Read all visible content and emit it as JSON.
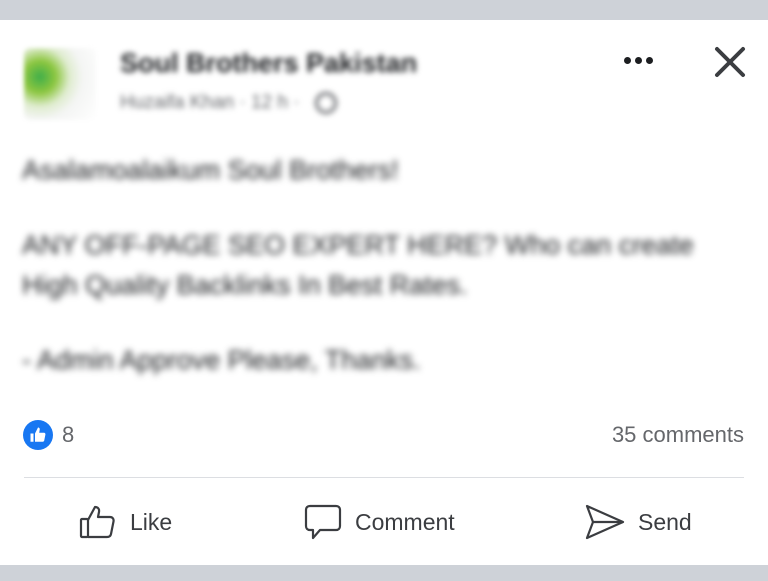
{
  "header": {
    "group_name": "Soul Brothers Pakistan",
    "author": "Huzaifa Khan",
    "time": "· 12 h ·"
  },
  "post": {
    "paragraphs": [
      "Asalamoalaikum Soul Brothers!",
      "ANY OFF-PAGE SEO EXPERT HERE? Who can create High Quality Backlinks In Best Rates.",
      "- Admin Approve Please, Thanks."
    ]
  },
  "stats": {
    "reaction_count": "8",
    "comments": "35 comments"
  },
  "actions": {
    "like": "Like",
    "comment": "Comment",
    "send": "Send"
  },
  "icons": {
    "reaction": "thumbs-up-icon",
    "more": "more-dots-icon",
    "close": "close-icon",
    "privacy": "globe-icon",
    "comment": "comment-bubble-icon",
    "send": "send-icon"
  },
  "colors": {
    "brand_blue": "#1877f2",
    "text": "#1c1e21",
    "secondary_text": "#65676b",
    "frame": "#ced2d8"
  }
}
